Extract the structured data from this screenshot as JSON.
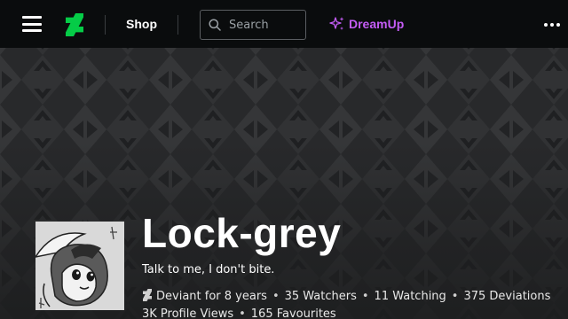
{
  "header": {
    "shop_label": "Shop",
    "search_placeholder": "Search",
    "dreamup_label": "DreamUp"
  },
  "colors": {
    "brand_green": "#05cc47",
    "dreamup_purple": "#c45cf5",
    "topbar_bg": "#0a0c0d"
  },
  "icons": [
    "menu-icon",
    "deviantart-logo-icon",
    "search-icon",
    "sparkle-icon",
    "more-dots-icon",
    "deviant-badge-icon"
  ],
  "profile": {
    "username": "Lock-grey",
    "tagline": "Talk to me, I don't bite.",
    "stats": {
      "deviant_for": "Deviant for 8 years",
      "watchers": "35 Watchers",
      "watching": "11 Watching",
      "deviations": "375 Deviations",
      "profile_views": "3K Profile Views",
      "favourites": "165 Favourites"
    }
  }
}
